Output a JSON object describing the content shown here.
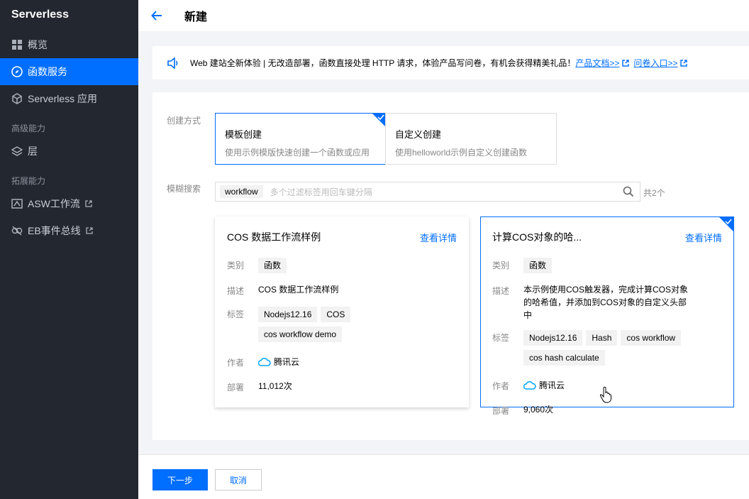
{
  "sidebar": {
    "brand": "Serverless",
    "items": [
      {
        "label": "概览",
        "icon": "grid-icon"
      },
      {
        "label": "函数服务",
        "icon": "compass-icon"
      },
      {
        "label": "Serverless 应用",
        "icon": "cube-icon"
      }
    ],
    "group_advanced": "高级能力",
    "layer_label": "层",
    "group_extension": "拓展能力",
    "asw_label": "ASW工作流",
    "eb_label": "EB事件总线"
  },
  "header": {
    "title": "新建"
  },
  "notice": {
    "text": "Web 建站全新体验 | 无改造部署，函数直接处理 HTTP 请求，体验产品写问卷，有机会获得精美礼品！",
    "link_docs": "产品文档>>",
    "link_survey": "问卷入口>>"
  },
  "form": {
    "create_mode_label": "创建方式",
    "modes": [
      {
        "title": "模板创建",
        "desc": "使用示例模版快速创建一个函数或应用"
      },
      {
        "title": "自定义创建",
        "desc": "使用helloworld示例自定义创建函数"
      }
    ],
    "search_label": "模糊搜索",
    "search_chip": "workflow",
    "search_placeholder": "多个过滤标签用回车键分隔",
    "result_count": "共2个"
  },
  "cards": [
    {
      "title": "COS 数据工作流样例",
      "detail": "查看详情",
      "category_label": "类别",
      "category": "函数",
      "desc_label": "描述",
      "desc": "COS 数据工作流样例",
      "tags_label": "标签",
      "tags": [
        "Nodejs12.16",
        "COS",
        "cos workflow demo"
      ],
      "author_label": "作者",
      "author": "腾讯云",
      "deploy_label": "部署",
      "deploy": "11,012次"
    },
    {
      "title": "计算COS对象的哈...",
      "detail": "查看详情",
      "category_label": "类别",
      "category": "函数",
      "desc_label": "描述",
      "desc": "本示例使用COS触发器，完成计算COS对象的哈希值，并添加到COS对象的自定义头部中",
      "tags_label": "标签",
      "tags": [
        "Nodejs12.16",
        "Hash",
        "cos workflow",
        "cos hash calculate"
      ],
      "author_label": "作者",
      "author": "腾讯云",
      "deploy_label": "部署",
      "deploy": "9,060次"
    }
  ],
  "footer": {
    "next": "下一步",
    "cancel": "取消"
  },
  "colors": {
    "accent": "#006eff",
    "sidebar_bg": "#23272f"
  }
}
